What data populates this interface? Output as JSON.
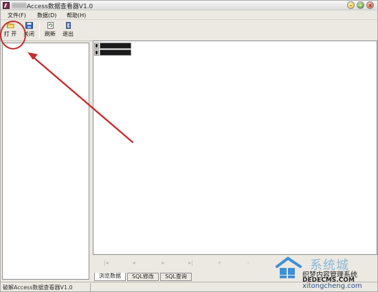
{
  "window": {
    "title": "Access数据查看器V1.0",
    "controls": {
      "minimize": "–",
      "maximize": "□",
      "close": "×"
    }
  },
  "menu": [
    {
      "label": "文件(F)"
    },
    {
      "label": "数据(D)"
    },
    {
      "label": "帮助(H)"
    }
  ],
  "toolbar": [
    {
      "label": "打 开",
      "icon": "open-folder-icon"
    },
    {
      "label": "关闭",
      "icon": "close-db-icon"
    },
    {
      "label": "刷新",
      "icon": "refresh-icon"
    },
    {
      "label": "退出",
      "icon": "exit-icon"
    }
  ],
  "navigator": [
    "|◂",
    "◂",
    "▸",
    "▸|",
    "+",
    "–"
  ],
  "tabs": [
    {
      "label": "浏览数据",
      "active": true
    },
    {
      "label": "SQL修改",
      "active": false
    },
    {
      "label": "SQL查询",
      "active": false
    }
  ],
  "status": {
    "text": "破解Access数据查看器V1.0"
  },
  "watermark": {
    "brand_cn": "系统城",
    "line1": "织梦内容管理系统",
    "line2": "DEDECMS.COM",
    "line3": "xitongcheng.com"
  },
  "colors": {
    "annotation": "#c42d2d",
    "window_bg": "#ece9e2",
    "grid_dark_cell": "#1b1b1b"
  }
}
